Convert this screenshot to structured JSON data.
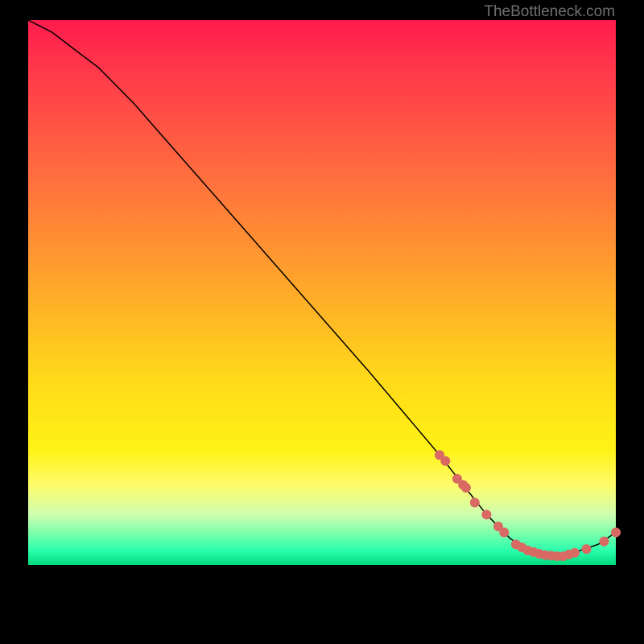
{
  "watermark": "TheBottleneck.com",
  "colors": {
    "gradient_top": "#ff1c4d",
    "gradient_mid": "#ffd91a",
    "gradient_green": "#2bffac",
    "curve": "#000000",
    "dots": "#d86a63",
    "background": "#000000"
  },
  "chart_data": {
    "type": "line",
    "title": "",
    "xlabel": "",
    "ylabel": "",
    "xlim": [
      0,
      100
    ],
    "ylim": [
      0,
      100
    ],
    "curve": {
      "x": [
        0,
        4,
        8,
        12,
        18,
        26,
        34,
        42,
        50,
        58,
        64,
        70,
        74,
        78,
        82,
        85,
        88,
        91,
        94,
        97,
        100
      ],
      "y": [
        100,
        98,
        95,
        92,
        86,
        77,
        68,
        59,
        50,
        41,
        34,
        27,
        22,
        17,
        13,
        11,
        10,
        10,
        11,
        12,
        14
      ]
    },
    "series": [
      {
        "name": "data-points",
        "x": [
          70,
          71,
          73,
          74,
          74.5,
          76,
          78,
          80,
          81,
          83,
          84,
          85,
          86,
          87,
          88,
          89,
          90,
          91,
          92,
          93,
          95,
          98,
          100
        ],
        "y": [
          27,
          26,
          23,
          22,
          21.5,
          19,
          17,
          15,
          14,
          12,
          11.5,
          11,
          10.7,
          10.4,
          10.2,
          10.1,
          10,
          10,
          10.3,
          10.6,
          11.2,
          12.5,
          14
        ]
      }
    ]
  }
}
